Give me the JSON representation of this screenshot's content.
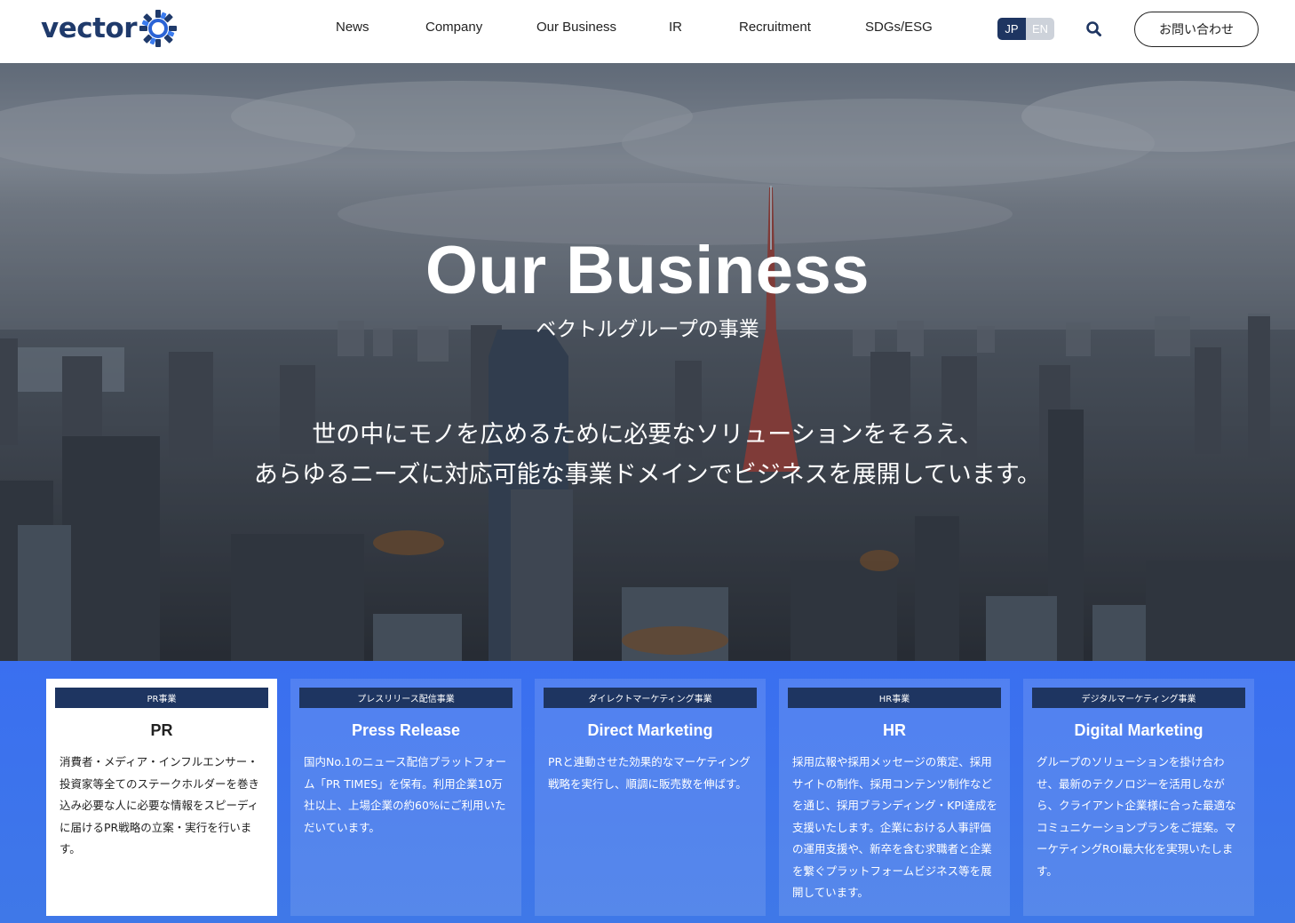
{
  "header": {
    "logo_text": "vector",
    "nav": [
      "News",
      "Company",
      "Our Business",
      "IR",
      "Recruitment",
      "SDGs/ESG"
    ],
    "lang": {
      "jp": "JP",
      "en": "EN",
      "active": "JP"
    },
    "search_icon": "search-icon",
    "contact_label": "お問い合わせ"
  },
  "hero": {
    "title": "Our Business",
    "subtitle": "ベクトルグループの事業",
    "description_line1": "世の中にモノを広めるために必要なソリューションをそろえ、",
    "description_line2": "あらゆるニーズに対応可能な事業ドメインでビジネスを展開しています。"
  },
  "businesses": [
    {
      "tag": "PR事業",
      "title": "PR",
      "body": "消費者・メディア・インフルエンサー・投資家等全てのステークホルダーを巻き込み必要な人に必要な情報をスピーディに届けるPR戦略の立案・実行を行います。"
    },
    {
      "tag": "プレスリリース配信事業",
      "title": "Press Release",
      "body": "国内No.1のニュース配信プラットフォーム「PR TIMES」を保有。利用企業10万社以上、上場企業の約60%にご利用いただいています。"
    },
    {
      "tag": "ダイレクトマーケティング事業",
      "title": "Direct Marketing",
      "body": "PRと連動させた効果的なマーケティング戦略を実行し、順調に販売数を伸ばす。"
    },
    {
      "tag": "HR事業",
      "title": "HR",
      "body": "採用広報や採用メッセージの策定、採用サイトの制作、採用コンテンツ制作などを通じ、採用ブランディング・KPI達成を支援いたします。企業における人事評価の運用支援や、新卒を含む求職者と企業を繋ぐプラットフォームビジネス等を展開しています。"
    },
    {
      "tag": "デジタルマーケティング事業",
      "title": "Digital Marketing",
      "body": "グループのソリューションを掛け合わせ、最新のテクノロジーを活用しながら、クライアント企業様に合った最適なコミュニケーションプランをご提案。マーケティングROI最大化を実現いたします。"
    }
  ],
  "colors": {
    "brand_navy": "#1e3561",
    "section_blue": "#3a6ff0"
  }
}
